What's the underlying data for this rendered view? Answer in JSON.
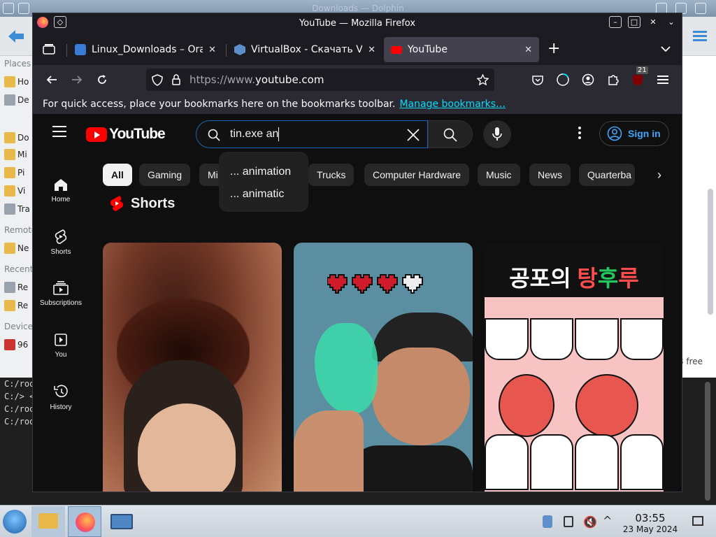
{
  "dolphin": {
    "title": "Downloads — Dolphin",
    "sidebar": {
      "places_label": "Places",
      "remote_label": "Remote",
      "recent_label": "Recent",
      "devices_label": "Devices",
      "items": [
        "Ho",
        "De",
        "Do",
        "Mi",
        "Pi",
        "Vi",
        "Tra",
        "Ne",
        "Re",
        "Re",
        "96"
      ]
    },
    "free_space": "iB free"
  },
  "terminal": {
    "lines": [
      "C:/roo",
      "C:/> <",
      "C:/roo",
      "C:/roo"
    ]
  },
  "firefox": {
    "window_title": "YouTube — Mozilla Firefox",
    "tabs": [
      {
        "title": "Linux_Downloads – Oracle",
        "close": "✕"
      },
      {
        "title": "VirtualBox - Скачать Virtu",
        "close": "✕"
      },
      {
        "title": "YouTube",
        "close": "✕"
      }
    ],
    "new_tab": "+",
    "url_scheme": "https://www.",
    "url_host": "youtube.com",
    "extensions_badge": "21",
    "bookmarks_hint": "For quick access, place your bookmarks here on the bookmarks toolbar.",
    "bookmarks_link": "Manage bookmarks…"
  },
  "youtube": {
    "logo_text": "YouTube",
    "search_value": "tin.exe an",
    "suggestions": [
      "... animation",
      "... animatic"
    ],
    "sign_in": "Sign in",
    "guide": [
      {
        "label": "Home",
        "icon": "home-icon"
      },
      {
        "label": "Shorts",
        "icon": "shorts-icon"
      },
      {
        "label": "Subscriptions",
        "icon": "subscriptions-icon"
      },
      {
        "label": "You",
        "icon": "you-icon"
      },
      {
        "label": "History",
        "icon": "history-icon"
      }
    ],
    "chips": [
      "All",
      "Gaming",
      "Mi",
      "Trucks",
      "Computer Hardware",
      "Music",
      "News",
      "Quarterba"
    ],
    "shorts_title": "Shorts",
    "short3_caption_white": "공포의",
    "short3_caption_red": "탕",
    "short3_caption_green": "후",
    "short3_caption_red2": "루"
  },
  "taskbar": {
    "time": "03:55",
    "date": "23 May 2024"
  },
  "colors": {
    "yt_red": "#ff0000",
    "link": "#3ea6ff",
    "firefox_bg": "#1c1b22"
  }
}
